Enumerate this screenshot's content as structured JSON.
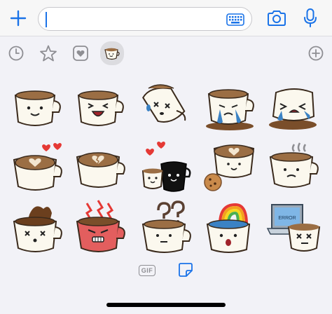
{
  "composer": {
    "placeholder": "",
    "value": ""
  },
  "icons": {
    "plus": "plus-icon",
    "keyboard": "keyboard-icon",
    "camera": "camera-icon",
    "mic": "microphone-icon",
    "recent": "clock-icon",
    "favorites": "star-icon",
    "mine": "heart-icon",
    "pack": "coffee-cup-sticker-icon",
    "add_pack": "add-circle-icon",
    "sticker_tray": "sticker-icon"
  },
  "colors": {
    "accent": "#1a73e8",
    "tab_gray": "#8e8e93",
    "cup_cream": "#fbf8ee",
    "coffee": "#9b6e44",
    "heart": "#e53935"
  },
  "stickers": [
    {
      "name": "coffee-cup-smiling"
    },
    {
      "name": "coffee-cup-laughing"
    },
    {
      "name": "coffee-cup-spilled-dizzy"
    },
    {
      "name": "coffee-cup-crying"
    },
    {
      "name": "coffee-cup-tipped-crying"
    },
    {
      "name": "coffee-cup-latte-heart"
    },
    {
      "name": "coffee-cup-broken-heart"
    },
    {
      "name": "coffee-couple-love"
    },
    {
      "name": "coffee-cup-with-cookie"
    },
    {
      "name": "coffee-cup-steaming-sad"
    },
    {
      "name": "coffee-cup-overflow-dead"
    },
    {
      "name": "coffee-cup-angry"
    },
    {
      "name": "coffee-cup-confused"
    },
    {
      "name": "coffee-cup-rainbow"
    },
    {
      "name": "coffee-cup-laptop-dead"
    }
  ],
  "laptop_screen_text": "ERROR",
  "bottom_bar": {
    "gif_label": "GIF"
  }
}
